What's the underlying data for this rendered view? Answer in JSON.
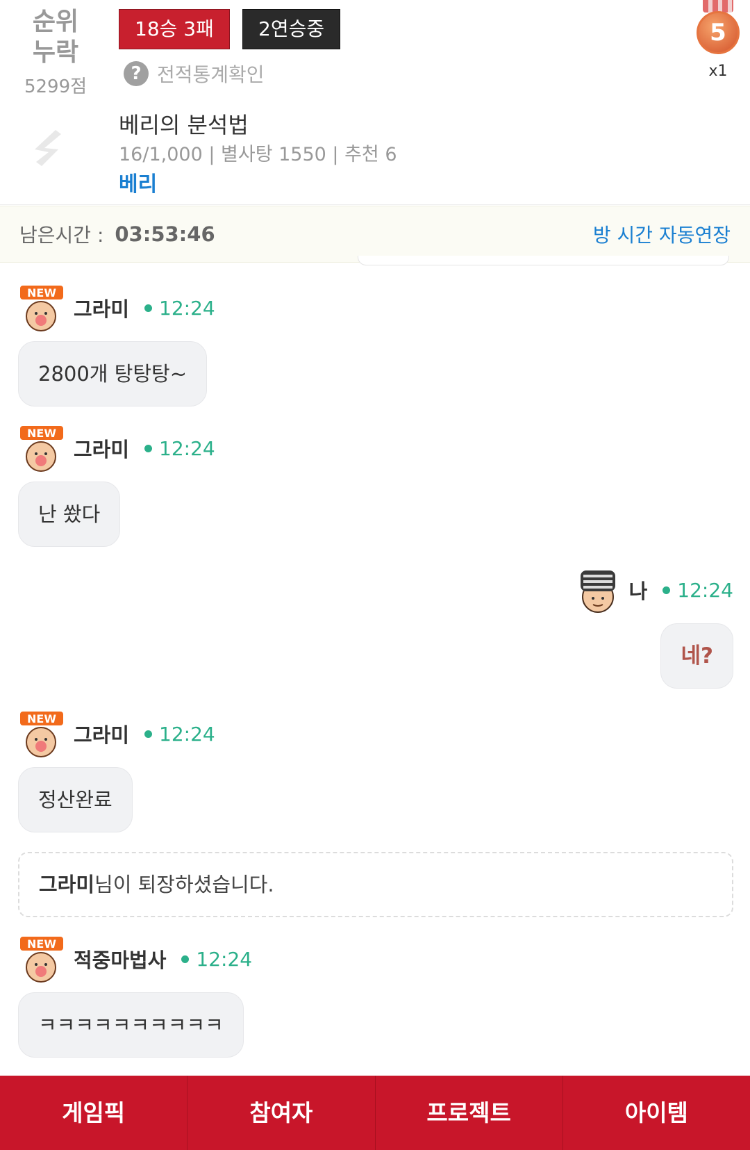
{
  "header": {
    "rank_label": "순위\n누락",
    "score": "5299점",
    "record": "18승 3패",
    "streak": "2연승중",
    "stats_link": "전적통계확인",
    "medal_number": "5",
    "medal_count": "x1",
    "post_title": "베리의 분석법",
    "post_meta": "16/1,000 | 별사탕 1550 | 추천 6",
    "post_author": "베리"
  },
  "timer": {
    "label": "남은시간 :",
    "value": "03:53:46",
    "extend_link": "방 시간 자동연장"
  },
  "messages": [
    {
      "user": "그라미",
      "time": "12:24",
      "text": "2800개 탕탕탕~",
      "badge": "NEW"
    },
    {
      "user": "그라미",
      "time": "12:24",
      "text": "난 쐈다",
      "badge": "NEW"
    },
    {
      "user": "나",
      "time": "12:24",
      "text": "네?"
    },
    {
      "user": "그라미",
      "time": "12:24",
      "text": "정산완료",
      "badge": "NEW"
    },
    {
      "user": "적중마법사",
      "time": "12:24",
      "text": "ㅋㅋㅋㅋㅋㅋㅋㅋㅋㅋ",
      "badge": "NEW"
    }
  ],
  "system_note": {
    "user": "그라미",
    "text": "님이 퇴장하셨습니다."
  },
  "nav": {
    "items": [
      "게임픽",
      "참여자",
      "프로젝트",
      "아이템"
    ]
  },
  "colors": {
    "brand_red": "#c8162a",
    "time_green": "#2bb08a",
    "link_blue": "#1a7fd1"
  }
}
